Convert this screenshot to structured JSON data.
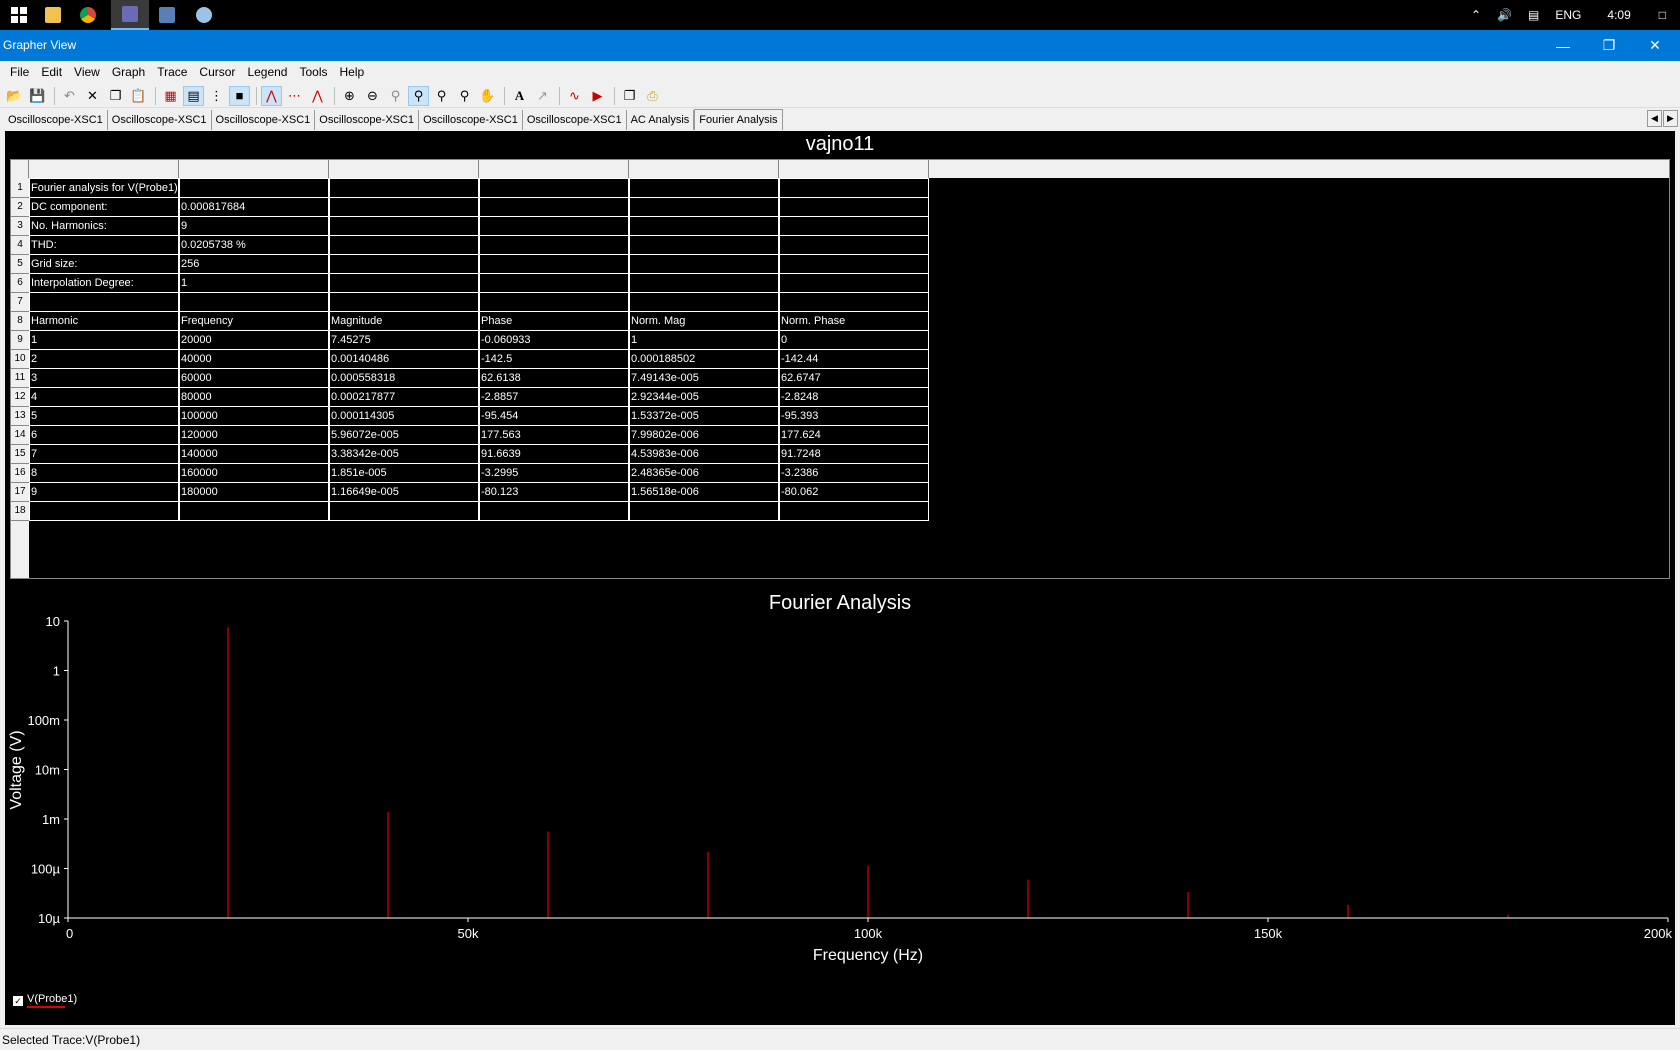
{
  "taskbar": {
    "icons": [
      "windows-start-icon",
      "file-explorer-icon",
      "chrome-icon",
      "multisim-icon",
      "grapher-icon",
      "app-icon"
    ],
    "tray": {
      "language": "ENG",
      "time": "4:09"
    }
  },
  "window": {
    "title": "Grapher View"
  },
  "menu": [
    "File",
    "Edit",
    "View",
    "Graph",
    "Trace",
    "Cursor",
    "Legend",
    "Tools",
    "Help"
  ],
  "tabs": [
    "Oscilloscope-XSC1",
    "Oscilloscope-XSC1",
    "Oscilloscope-XSC1",
    "Oscilloscope-XSC1",
    "Oscilloscope-XSC1",
    "Oscilloscope-XSC1",
    "AC Analysis",
    "Fourier Analysis"
  ],
  "active_tab": "Fourier Analysis",
  "page": {
    "title": "vajno11"
  },
  "grid": {
    "rows": [
      [
        "Fourier analysis for V(Probe1):",
        "",
        "",
        "",
        "",
        ""
      ],
      [
        "DC component:",
        "0.000817684",
        "",
        "",
        "",
        ""
      ],
      [
        "No. Harmonics:",
        "9",
        "",
        "",
        "",
        ""
      ],
      [
        "THD:",
        "0.0205738 %",
        "",
        "",
        "",
        ""
      ],
      [
        "Grid size:",
        "256",
        "",
        "",
        "",
        ""
      ],
      [
        "Interpolation Degree:",
        "1",
        "",
        "",
        "",
        ""
      ],
      [
        "",
        "",
        "",
        "",
        "",
        ""
      ],
      [
        "Harmonic",
        "Frequency",
        "Magnitude",
        "Phase",
        "Norm. Mag",
        "Norm. Phase"
      ],
      [
        "1",
        "20000",
        "7.45275",
        "-0.060933",
        "1",
        "0"
      ],
      [
        "2",
        "40000",
        "0.00140486",
        "-142.5",
        "0.000188502",
        "-142.44"
      ],
      [
        "3",
        "60000",
        "0.000558318",
        "62.6138",
        "7.49143e-005",
        "62.6747"
      ],
      [
        "4",
        "80000",
        "0.000217877",
        "-2.8857",
        "2.92344e-005",
        "-2.8248"
      ],
      [
        "5",
        "100000",
        "0.000114305",
        "-95.454",
        "1.53372e-005",
        "-95.393"
      ],
      [
        "6",
        "120000",
        "5.96072e-005",
        "177.563",
        "7.99802e-006",
        "177.624"
      ],
      [
        "7",
        "140000",
        "3.38342e-005",
        "91.6639",
        "4.53983e-006",
        "91.7248"
      ],
      [
        "8",
        "160000",
        "1.851e-005",
        "-3.2995",
        "2.48365e-006",
        "-3.2386"
      ],
      [
        "9",
        "180000",
        "1.16649e-005",
        "-80.123",
        "1.56518e-006",
        "-80.062"
      ],
      [
        "",
        "",
        "",
        "",
        "",
        ""
      ]
    ]
  },
  "chart_data": {
    "type": "bar",
    "title": "Fourier Analysis",
    "xlabel": "Frequency (Hz)",
    "ylabel": "Voltage (V)",
    "x_scale": "linear",
    "y_scale": "log",
    "xlim": [
      0,
      200000
    ],
    "ylim": [
      1e-05,
      10
    ],
    "x_ticks": [
      0,
      50000,
      100000,
      150000,
      200000
    ],
    "x_tick_labels": [
      "0",
      "50k",
      "100k",
      "150k",
      "200k"
    ],
    "y_ticks": [
      10,
      1,
      0.1,
      0.01,
      0.001,
      0.0001,
      1e-05
    ],
    "y_tick_labels": [
      "10",
      "1",
      "100m",
      "10m",
      "1m",
      "100µ",
      "10µ"
    ],
    "series": [
      {
        "name": "V(Probe1)",
        "color": "#e00000",
        "x": [
          20000,
          40000,
          60000,
          80000,
          100000,
          120000,
          140000,
          160000,
          180000
        ],
        "values": [
          7.45275,
          0.00140486,
          0.000558318,
          0.000217877,
          0.000114305,
          5.96072e-05,
          3.38342e-05,
          1.851e-05,
          1.16649e-05
        ]
      }
    ],
    "grid": false,
    "legend": "bottom-left"
  },
  "status": {
    "text": "Selected Trace:V(Probe1)"
  }
}
